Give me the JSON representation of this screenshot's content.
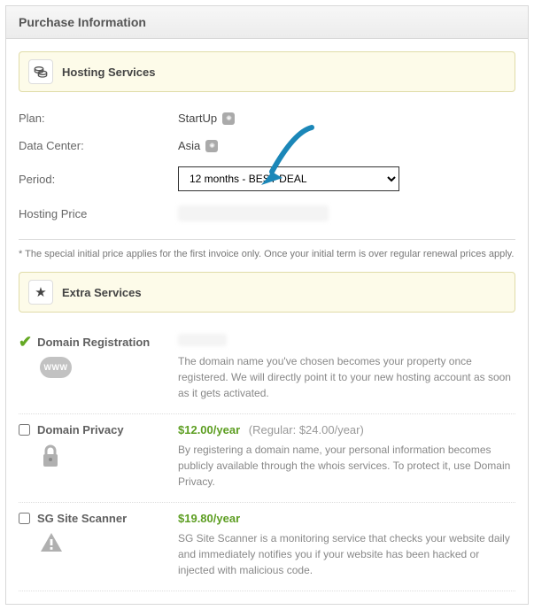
{
  "header": {
    "title": "Purchase Information"
  },
  "hosting": {
    "section_title": "Hosting Services",
    "plan_label": "Plan:",
    "plan_value": "StartUp",
    "dc_label": "Data Center:",
    "dc_value": "Asia",
    "period_label": "Period:",
    "period_value": "12 months - BEST DEAL",
    "price_label": "Hosting Price",
    "footnote": "* The special initial price applies for the first invoice only. Once your initial term is over regular renewal prices apply."
  },
  "extras": {
    "section_title": "Extra Services",
    "domain_reg": {
      "label": "Domain Registration",
      "desc": "The domain name you've chosen becomes your property once registered. We will directly point it to your new hosting account as soon as it gets activated."
    },
    "domain_privacy": {
      "label": "Domain Privacy",
      "price": "$12.00/year",
      "regular": "(Regular: $24.00/year)",
      "desc": "By registering a domain name, your personal information becomes publicly available through the whois services. To protect it, use Domain Privacy."
    },
    "site_scanner": {
      "label": "SG Site Scanner",
      "price": "$19.80/year",
      "desc": "SG Site Scanner is a monitoring service that checks your website daily and immediately notifies you if your website has been hacked or injected with malicious code."
    }
  }
}
